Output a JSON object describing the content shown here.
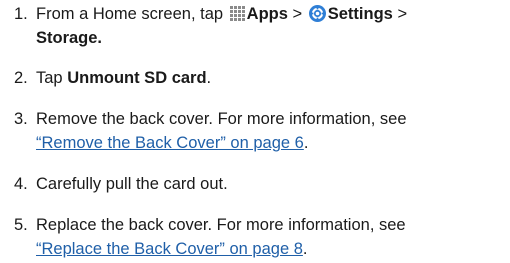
{
  "steps": [
    {
      "num": "1.",
      "pre": "From a Home screen, tap",
      "apps_label": "Apps",
      "sep1": ">",
      "settings_label": "Settings",
      "sep2": ">",
      "line2": "Storage."
    },
    {
      "num": "2.",
      "pre": "Tap",
      "bold": "Unmount SD card",
      "post": "."
    },
    {
      "num": "3.",
      "text": "Remove the back cover. For more information, see",
      "link": "“Remove the Back Cover” on page 6",
      "post": "."
    },
    {
      "num": "4.",
      "text": "Carefully pull the card out."
    },
    {
      "num": "5.",
      "text": "Replace the back cover. For more information, see",
      "link": "“Replace the Back Cover” on page 8",
      "post": "."
    }
  ],
  "icons": {
    "apps": "apps-grid-icon",
    "settings": "settings-gear-icon"
  },
  "colors": {
    "text": "#1a1a1a",
    "link": "#1f5fa8",
    "settings_icon": "#2f7fd6"
  }
}
